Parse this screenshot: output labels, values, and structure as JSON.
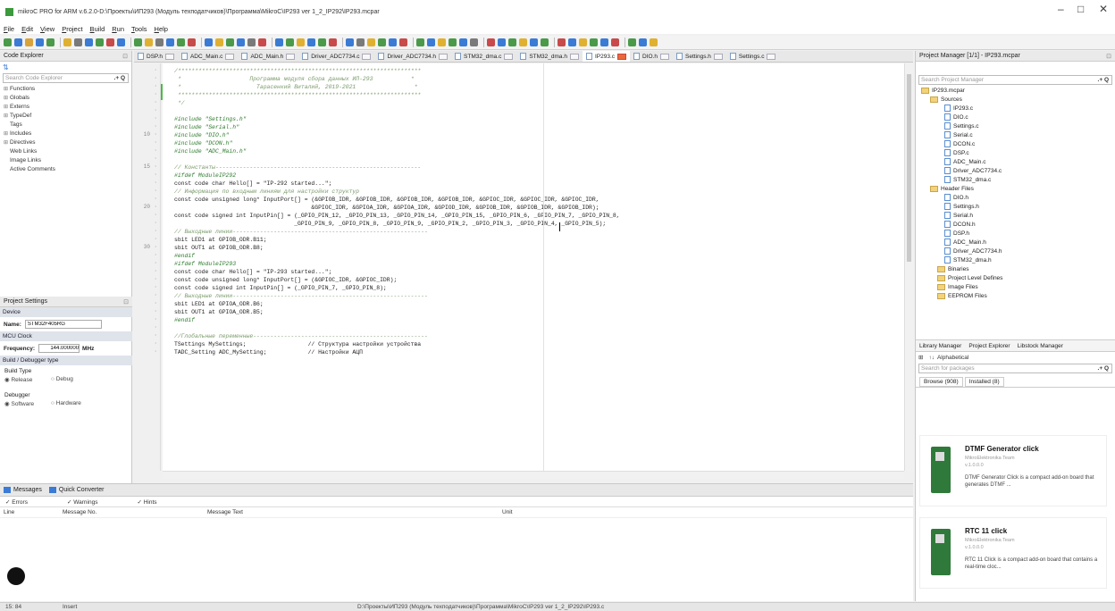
{
  "window": {
    "title": "mikroC PRO for ARM v.6.2.0-D:\\Проекты\\ИП293 (Модуль техподатчиков)\\Программа\\MikroC\\IP293 ver 1_2_IP292\\IP293.mcpar",
    "minimize": "–",
    "maximize": "□",
    "close": "✕"
  },
  "menu": [
    "File",
    "Edit",
    "View",
    "Project",
    "Build",
    "Run",
    "Tools",
    "Help"
  ],
  "code_explorer": {
    "title": "Code Explorer",
    "search_placeholder": "Search Code Explorer",
    "items": [
      "Functions",
      "Globals",
      "Externs",
      "TypeDef",
      "Tags",
      "Includes",
      "Directives",
      "Web Links",
      "Image Links",
      "Active Comments"
    ]
  },
  "project_settings": {
    "title": "Project Settings",
    "device_label": "Device",
    "name_label": "Name:",
    "name_value": "STM32F405RG",
    "mcu_clock_label": "MCU Clock",
    "frequency_label": "Frequency:",
    "frequency_value": "144.000000",
    "frequency_unit": "MHz",
    "build_type_label": "Build / Debugger type",
    "build_type_sub": "Build Type",
    "release": "Release",
    "debug": "Debug",
    "debugger_label": "Debugger",
    "software": "Software",
    "hardware": "Hardware"
  },
  "tabs": [
    {
      "label": "DSP.h",
      "active": false
    },
    {
      "label": "ADC_Main.c",
      "active": false
    },
    {
      "label": "ADC_Main.h",
      "active": false
    },
    {
      "label": "Driver_ADC7734.c",
      "active": false
    },
    {
      "label": "Driver_ADC7734.h",
      "active": false
    },
    {
      "label": "STM32_dma.c",
      "active": false
    },
    {
      "label": "STM32_dma.h",
      "active": false
    },
    {
      "label": "IP293.c",
      "active": true
    },
    {
      "label": "DIO.h",
      "active": false
    },
    {
      "label": "Settings.h",
      "active": false
    },
    {
      "label": "Settings.c",
      "active": false
    }
  ],
  "gutter_numbers": [
    {
      "line": 6,
      "label": "10"
    },
    {
      "line": 10,
      "label": "15"
    },
    {
      "line": 15,
      "label": "20"
    },
    {
      "line": 20,
      "label": "30"
    }
  ],
  "code": [
    {
      "cls": "c-cm",
      "text": "/***********************************************************************"
    },
    {
      "cls": "c-cm",
      "text": " *                    Программа модуля сбора данных ИП-293           *"
    },
    {
      "cls": "c-cm",
      "text": " *                      Тарасенкий Виталий, 2019-2021                 *"
    },
    {
      "cls": "c-cm",
      "text": " ***********************************************************************"
    },
    {
      "cls": "c-cm",
      "text": " */"
    },
    {
      "cls": "c-tx",
      "text": ""
    },
    {
      "cls": "c-pp",
      "text": "#include \"Settings.h\""
    },
    {
      "cls": "c-pp",
      "text": "#include \"Serial.h\""
    },
    {
      "cls": "c-pp",
      "text": "#include \"DIO.h\""
    },
    {
      "cls": "c-pp",
      "text": "#include \"DCON.h\""
    },
    {
      "cls": "c-pp",
      "text": "#include \"ADC_Main.h\""
    },
    {
      "cls": "c-tx",
      "text": ""
    },
    {
      "cls": "c-cm",
      "text": "// Константы------------------------------------------------------------"
    },
    {
      "cls": "c-pp",
      "text": "#ifdef ModuleIP292"
    },
    {
      "cls": "c-tx",
      "text": "const code char Hello[] = \"IP-292 started...\";"
    },
    {
      "cls": "c-cm",
      "text": "// Информация по входным линиям для настройки структур"
    },
    {
      "cls": "c-tx",
      "text": "const code unsigned long* InputPort[] = (&GPIOB_IDR, &GPIOB_IDR, &GPIOB_IDR, &GPIOB_IDR, &GPIOC_IDR, &GPIOC_IDR, &GPIOC_IDR,"
    },
    {
      "cls": "c-tx",
      "text": "                                        &GPIOC_IDR, &GPIOA_IDR, &GPIOA_IDR, &GPIOD_IDR, &GPIOB_IDR, &GPIOB_IDR, &GPIOB_IDR);"
    },
    {
      "cls": "c-tx",
      "text": "const code signed int InputPin[] = (_GPIO_PIN_12, _GPIO_PIN_13, _GPIO_PIN_14, _GPIO_PIN_15, _GPIO_PIN_6, _GPIO_PIN_7, _GPIO_PIN_8,"
    },
    {
      "cls": "c-tx",
      "text": "                                   _GPIO_PIN_9, _GPIO_PIN_8, _GPIO_PIN_9, _GPIO_PIN_2, _GPIO_PIN_3, _GPIO_PIN_4, _GPIO_PIN_5);"
    },
    {
      "cls": "c-cm",
      "text": "// Выходные линии---------------------------------------------------------"
    },
    {
      "cls": "c-tx",
      "text": "sbit LED1 at GPIOB_ODR.B11;"
    },
    {
      "cls": "c-tx",
      "text": "sbit OUT1 at GPIOB_ODR.B8;"
    },
    {
      "cls": "c-pp",
      "text": "#endif"
    },
    {
      "cls": "c-pp",
      "text": "#ifdef ModuleIP293"
    },
    {
      "cls": "c-tx",
      "text": "const code char Hello[] = \"IP-293 started...\";"
    },
    {
      "cls": "c-tx",
      "text": "const code unsigned long* InputPort[] = (&GPIOC_IDR, &GPIOC_IDR);"
    },
    {
      "cls": "c-tx",
      "text": "const code signed int InputPin[] = (_GPIO_PIN_7, _GPIO_PIN_8);"
    },
    {
      "cls": "c-cm",
      "text": "// Выходные линии---------------------------------------------------------"
    },
    {
      "cls": "c-tx",
      "text": "sbit LED1 at GPIOA_ODR.B6;"
    },
    {
      "cls": "c-tx",
      "text": "sbit OUT1 at GPIOA_ODR.B5;"
    },
    {
      "cls": "c-pp",
      "text": "#endif"
    },
    {
      "cls": "c-tx",
      "text": ""
    },
    {
      "cls": "c-cm",
      "text": "//Глобальные переменные---------------------------------------------------"
    },
    {
      "cls": "c-tx",
      "text": "TSettings MySettings;                  // Структура настройки устройства"
    },
    {
      "cls": "c-tx",
      "text": "TADC_Setting ADC_MySetting;            // Настройки АЦП"
    }
  ],
  "messages": {
    "tab1": "Messages",
    "tab2": "Quick Converter",
    "errors": "Errors",
    "warnings": "Warnings",
    "hints": "Hints",
    "col_line": "Line",
    "col_msgno": "Message No.",
    "col_text": "Message Text",
    "col_unit": "Unit"
  },
  "project_manager": {
    "title": "Project Manager [1/1] - IP293.mcpar",
    "search_placeholder": "Search Project Manager",
    "root": "IP293.mcpar",
    "sources_label": "Sources",
    "sources": [
      "IP293.c",
      "DIO.c",
      "Settings.c",
      "Serial.c",
      "DCON.c",
      "DSP.c",
      "ADC_Main.c",
      "Driver_ADC7734.c",
      "STM32_dma.c"
    ],
    "headers_label": "Header Files",
    "headers": [
      "DIO.h",
      "Settings.h",
      "Serial.h",
      "DCON.h",
      "DSP.h",
      "ADC_Main.h",
      "Driver_ADC7734.h",
      "STM32_dma.h"
    ],
    "other_folders": [
      "Binaries",
      "Project Level Defines",
      "Image Files",
      "EEPROM Files"
    ]
  },
  "library": {
    "tab_library_manager": "Library Manager",
    "tab_project_explorer": "Project Explorer",
    "tab_libstock": "Libstock Manager",
    "sort_label": "Alphabetical",
    "search_placeholder": "Search for packages",
    "browse_tab": "Browse (908)",
    "installed_tab": "Installed (8)",
    "cards": [
      {
        "title": "DTMF Generator click",
        "author": "MikroElektronika Team",
        "version": "v.1.0.0.0",
        "description": "DTMF Generator Click is a compact add-on board that generates DTMF ..."
      },
      {
        "title": "RTC 11 click",
        "author": "MikroElektronika Team",
        "version": "v.1.0.0.0",
        "description": "RTC 11 Click is a compact add-on board that contains a real-time cloc..."
      }
    ]
  },
  "status": {
    "position": "15: 84",
    "mode": "Insert",
    "path": "D:\\Проекты\\ИП293 (Модуль техподатчиков)\\Программа\\MikroC\\IP293 ver 1_2_IP292\\IP293.c"
  }
}
